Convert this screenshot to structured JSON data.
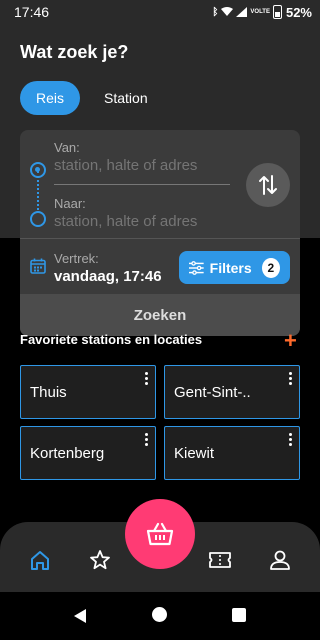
{
  "status_bar": {
    "time": "17:46",
    "battery": "52%",
    "network": "VOLTE"
  },
  "page": {
    "title": "Wat zoek je?"
  },
  "tabs": [
    {
      "label": "Reis",
      "active": true
    },
    {
      "label": "Station",
      "active": false
    }
  ],
  "search": {
    "from_label": "Van:",
    "from_placeholder": "station, halte of adres",
    "to_label": "Naar:",
    "to_placeholder": "station, halte of adres",
    "depart_label": "Vertrek:",
    "depart_value": "vandaag, 17:46",
    "filters_label": "Filters",
    "filters_count": "2",
    "search_button": "Zoeken"
  },
  "favorites": {
    "title": "Favoriete stations en locaties",
    "items": [
      {
        "label": "Thuis"
      },
      {
        "label": "Gent-Sint-.."
      },
      {
        "label": "Kortenberg"
      },
      {
        "label": "Kiewit"
      }
    ]
  },
  "bottom_nav": {
    "items": [
      {
        "icon": "home-icon",
        "active": true
      },
      {
        "icon": "star-icon"
      },
      {
        "icon": "basket-icon"
      },
      {
        "icon": "ticket-icon"
      },
      {
        "icon": "user-icon"
      }
    ]
  },
  "colors": {
    "accent": "#2f97e6",
    "fab": "#ff3b74",
    "add": "#ff6a2b",
    "surface": "#2a2a2a",
    "card": "#3b3b3b"
  }
}
